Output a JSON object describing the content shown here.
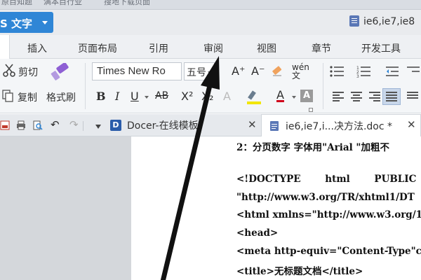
{
  "top_strip": {
    "text_left": "原目知题",
    "text_mid": "满本目行业",
    "text_right": "搜地下载页面"
  },
  "app": {
    "button_label": "S 文字",
    "window_title": "ie6,ie7,ie8",
    "accent_color": "#2f86d6"
  },
  "ribbon_tabs": [
    "插入",
    "页面布局",
    "引用",
    "审阅",
    "视图",
    "章节",
    "开发工具"
  ],
  "ribbon": {
    "cut_label": "剪切",
    "copy_label": "复制",
    "format_painter_label": "格式刷",
    "font_name": "Times New Ro",
    "font_size": "五号",
    "bold": "B",
    "italic": "I",
    "underline": "U",
    "strikethrough": "AB",
    "superscript": "X²",
    "subscript": "X₂",
    "grow_font": "A⁺",
    "shrink_font": "A⁻",
    "phonetic": "wén 文",
    "highlight_color": "#f2e600",
    "font_color": "#d0021b"
  },
  "doc_tabs": {
    "docer_label": "Docer-在线模板",
    "active_label": "ie6,ie7,i...决方法.doc *"
  },
  "document": {
    "lines": [
      "2：分页数字 字体用\"Arial \"加粗不",
      "<!DOCTYPE  html  PUBLIC",
      "\"http://www.w3.org/TR/xhtml1/DT",
      "<html xmlns=\"http://www.w3.org/1",
      "<head>",
      "<meta http-equiv=\"Content-Type\"c",
      "<title>无标题文档</title>"
    ]
  }
}
